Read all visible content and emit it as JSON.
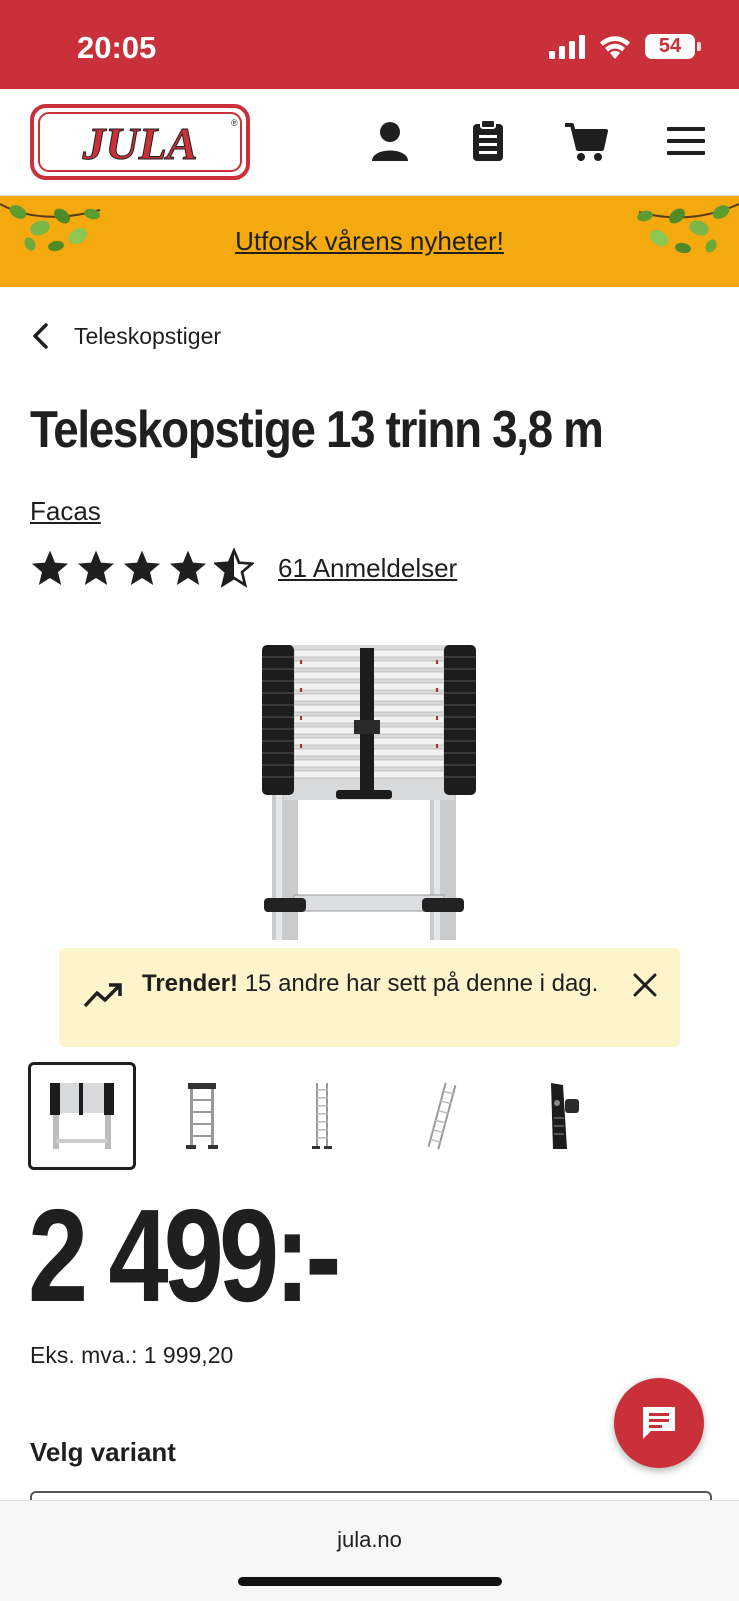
{
  "status": {
    "time": "20:05",
    "battery": "54"
  },
  "header": {
    "logo_text": "JULA",
    "icons": [
      "account-icon",
      "shopping-list-icon",
      "cart-icon",
      "menu-icon"
    ]
  },
  "promo": {
    "text": "Utforsk vårens nyheter!"
  },
  "breadcrumb": {
    "label": "Teleskopstiger"
  },
  "product": {
    "title": "Teleskopstige 13 trinn 3,8 m",
    "brand": "Facas",
    "rating": 4.5,
    "reviews_label": "61 Anmeldelser",
    "price": "2 499:-",
    "ex_vat": "Eks. mva.: 1 999,20"
  },
  "trend": {
    "bold": "Trender!",
    "text": " 15 andre har sett på denne i dag."
  },
  "thumbnails": [
    "thumbnail-1",
    "thumbnail-2",
    "thumbnail-3",
    "thumbnail-4",
    "thumbnail-5"
  ],
  "variant": {
    "label": "Velg variant"
  },
  "browser": {
    "url": "jula.no"
  },
  "colors": {
    "brand_red": "#c9303a",
    "promo_yellow": "#f4a90e",
    "trend_bg": "#fdf4cc"
  }
}
